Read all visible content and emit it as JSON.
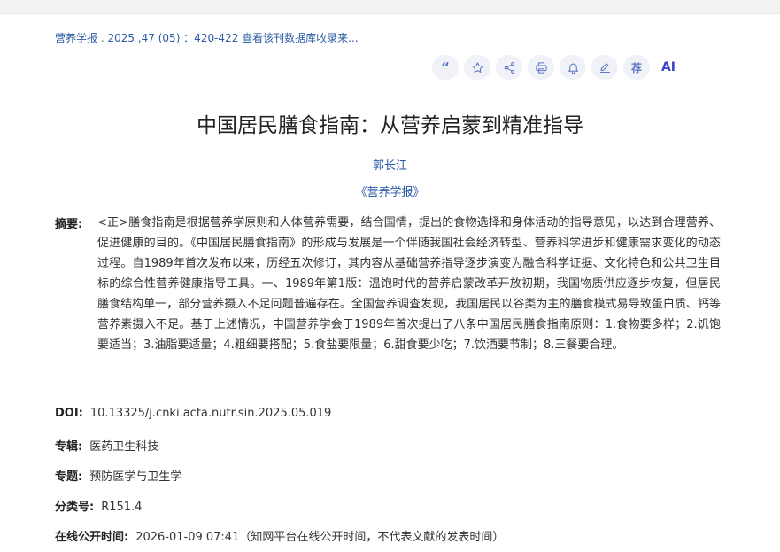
{
  "breadcrumb": {
    "journal": "营养学报",
    "issue": "2025 ,47 (05) ：420-422",
    "db_link": "查看该刊数据库收录来..."
  },
  "toolbar": {
    "cite": "cite",
    "favorite": "favorite",
    "share": "share",
    "print": "print",
    "alert": "alert",
    "note": "note",
    "recommend_label": "荐",
    "ai_label": "AI"
  },
  "article": {
    "title": "中国居民膳食指南：从营养启蒙到精准指导",
    "author": "郭长江",
    "journal": "《营养学报》"
  },
  "abstract": {
    "label": "摘要:",
    "text": "<正>膳食指南是根据营养学原则和人体营养需要，结合国情，提出的食物选择和身体活动的指导意见，以达到合理营养、促进健康的目的。《中国居民膳食指南》的形成与发展是一个伴随我国社会经济转型、营养科学进步和健康需求变化的动态过程。自1989年首次发布以来，历经五次修订，其内容从基础营养指导逐步演变为融合科学证据、文化特色和公共卫生目标的综合性营养健康指导工具。一、1989年第1版：温饱时代的营养启蒙改革开放初期，我国物质供应逐步恢复，但居民膳食结构单一，部分营养摄入不足问题普遍存在。全国营养调查发现，我国居民以谷类为主的膳食模式易导致蛋白质、钙等营养素摄入不足。基于上述情况，中国营养学会于1989年首次提出了八条中国居民膳食指南原则：1.食物要多样；2.饥饱要适当；3.油脂要适量；4.粗细要搭配；5.食盐要限量；6.甜食要少吃；7.饮酒要节制；8.三餐要合理。"
  },
  "meta": {
    "doi_label": "DOI:",
    "doi": "10.13325/j.cnki.acta.nutr.sin.2025.05.019",
    "series_label": "专辑:",
    "series": "医药卫生科技",
    "topic_label": "专题:",
    "topic": "预防医学与卫生学",
    "class_label": "分类号:",
    "class": "R151.4",
    "online_label": "在线公开时间:",
    "online": "2026-01-09 07:41（知网平台在线公开时间，不代表文献的发表时间）"
  }
}
